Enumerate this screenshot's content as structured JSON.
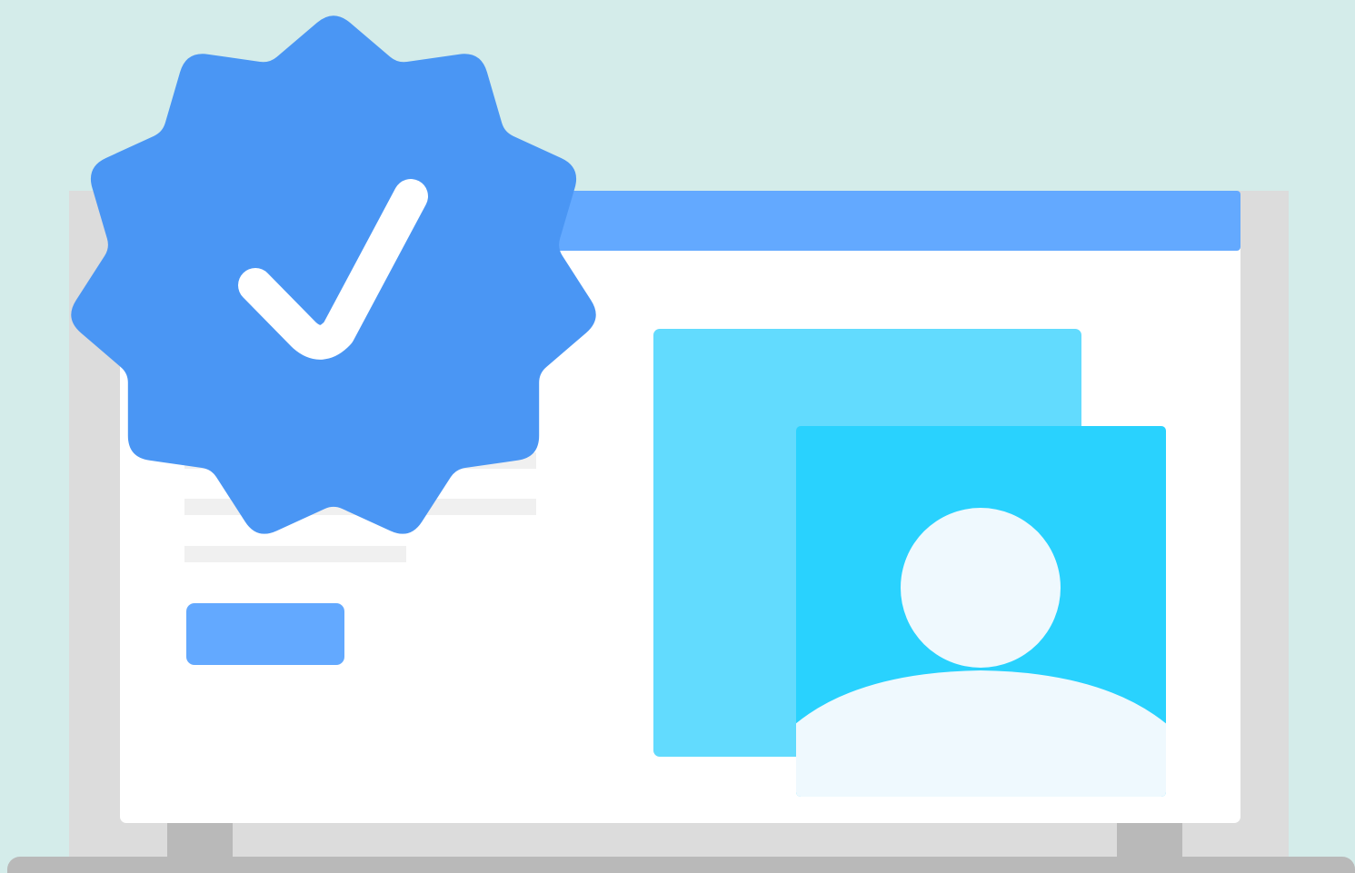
{
  "illustration": {
    "subject": "verified-account-laptop",
    "icons": [
      "verified-badge-icon",
      "checkmark-icon",
      "user-avatar-icon"
    ]
  },
  "colors": {
    "background": "#d4ecea",
    "laptop_frame": "#dcdcdc",
    "laptop_base": "#b9b9b9",
    "screen": "#ffffff",
    "title_bar": "#63a9ff",
    "badge": "#4a96f4",
    "checkmark": "#ffffff",
    "photo_back": "#62dbfe",
    "photo_front": "#29d2fe",
    "avatar": "#eff9fe",
    "text_placeholder": "#f0f0f0",
    "button": "#63a9ff"
  }
}
